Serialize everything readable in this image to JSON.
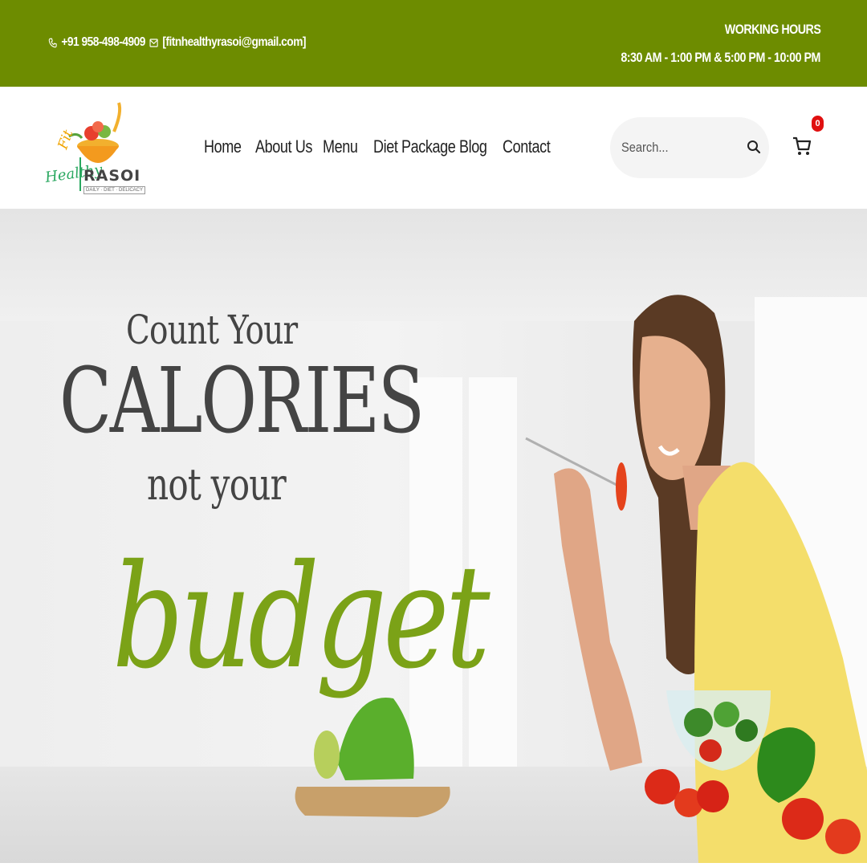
{
  "topbar": {
    "phone": "+91 958-498-4909",
    "email": "[fitnhealthyrasoi@gmail.com]",
    "hours_title": "WORKING HOURS",
    "hours_value": "8:30 AM - 1:00 PM & 5:00 PM - 10:00 PM",
    "background_color": "#6d8c00",
    "icons": [
      "phone-icon",
      "mail-icon"
    ]
  },
  "logo": {
    "fit": "Fit",
    "n": "n",
    "healthy": "Healthy",
    "rasoi": "RASOI",
    "tagline": "DAILY · DIET · DELICACY"
  },
  "nav": {
    "items": [
      {
        "label": "Home"
      },
      {
        "label": "About Us"
      },
      {
        "label": "Menu"
      },
      {
        "label": "Diet Package"
      },
      {
        "label": "Blog"
      },
      {
        "label": "Contact"
      }
    ]
  },
  "search": {
    "placeholder": "Search...",
    "icon": "search-icon"
  },
  "cart": {
    "count": "0",
    "icon": "cart-icon",
    "badge_color": "#e01010"
  },
  "hero": {
    "line1": "Count Your",
    "line2": "CALORIES",
    "line3": "not your",
    "line4": "budget",
    "text_color": "#444444",
    "accent_color": "#7ba217"
  }
}
